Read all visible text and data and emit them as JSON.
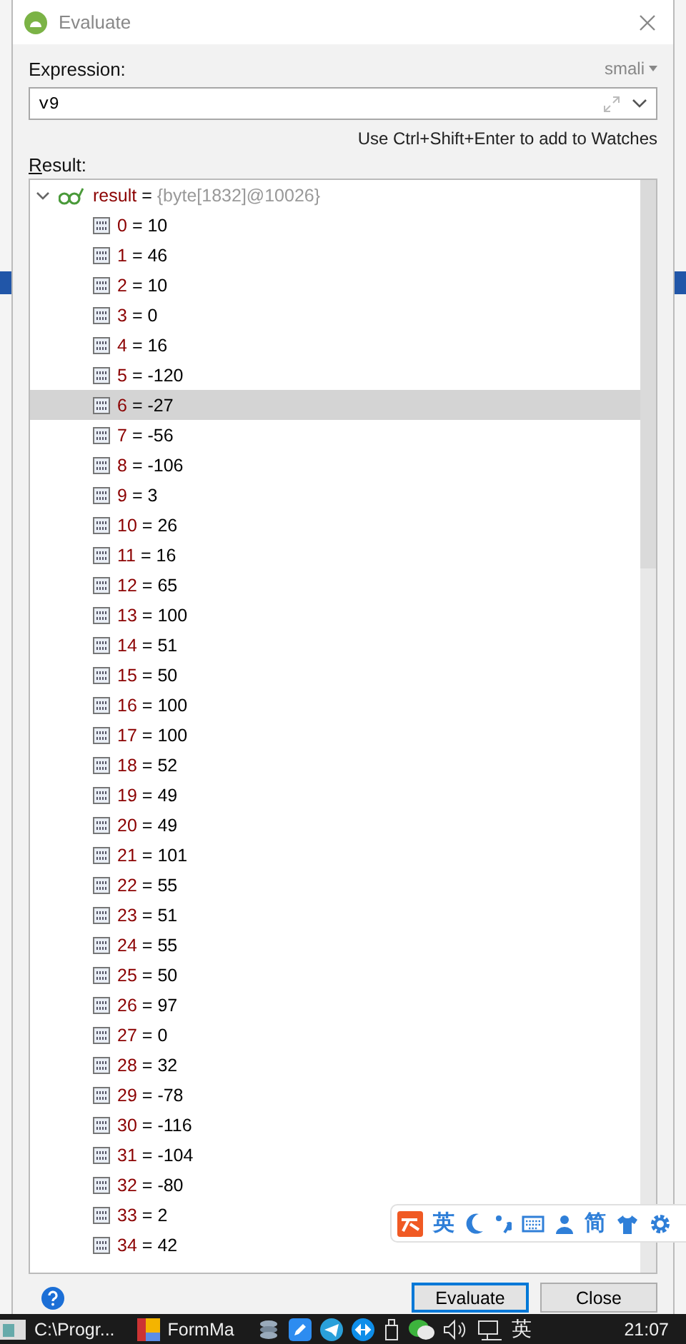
{
  "window": {
    "title": "Evaluate"
  },
  "expression": {
    "label": "Expression:",
    "language": "smali",
    "value": "v9"
  },
  "hint": "Use Ctrl+Shift+Enter to add to Watches",
  "result": {
    "label": "Result:",
    "separator": "=",
    "root": {
      "name": "result",
      "value": "{byte[1832]@10026}",
      "expanded": true,
      "children": [
        {
          "index": "0",
          "value": "10",
          "selected": false
        },
        {
          "index": "1",
          "value": "46",
          "selected": false
        },
        {
          "index": "2",
          "value": "10",
          "selected": false
        },
        {
          "index": "3",
          "value": "0",
          "selected": false
        },
        {
          "index": "4",
          "value": "16",
          "selected": false
        },
        {
          "index": "5",
          "value": "-120",
          "selected": false
        },
        {
          "index": "6",
          "value": "-27",
          "selected": true
        },
        {
          "index": "7",
          "value": "-56",
          "selected": false
        },
        {
          "index": "8",
          "value": "-106",
          "selected": false
        },
        {
          "index": "9",
          "value": "3",
          "selected": false
        },
        {
          "index": "10",
          "value": "26",
          "selected": false
        },
        {
          "index": "11",
          "value": "16",
          "selected": false
        },
        {
          "index": "12",
          "value": "65",
          "selected": false
        },
        {
          "index": "13",
          "value": "100",
          "selected": false
        },
        {
          "index": "14",
          "value": "51",
          "selected": false
        },
        {
          "index": "15",
          "value": "50",
          "selected": false
        },
        {
          "index": "16",
          "value": "100",
          "selected": false
        },
        {
          "index": "17",
          "value": "100",
          "selected": false
        },
        {
          "index": "18",
          "value": "52",
          "selected": false
        },
        {
          "index": "19",
          "value": "49",
          "selected": false
        },
        {
          "index": "20",
          "value": "49",
          "selected": false
        },
        {
          "index": "21",
          "value": "101",
          "selected": false
        },
        {
          "index": "22",
          "value": "55",
          "selected": false
        },
        {
          "index": "23",
          "value": "51",
          "selected": false
        },
        {
          "index": "24",
          "value": "55",
          "selected": false
        },
        {
          "index": "25",
          "value": "50",
          "selected": false
        },
        {
          "index": "26",
          "value": "97",
          "selected": false
        },
        {
          "index": "27",
          "value": "0",
          "selected": false
        },
        {
          "index": "28",
          "value": "32",
          "selected": false
        },
        {
          "index": "29",
          "value": "-78",
          "selected": false
        },
        {
          "index": "30",
          "value": "-116",
          "selected": false
        },
        {
          "index": "31",
          "value": "-104",
          "selected": false
        },
        {
          "index": "32",
          "value": "-80",
          "selected": false
        },
        {
          "index": "33",
          "value": "2",
          "selected": false
        },
        {
          "index": "34",
          "value": "42",
          "selected": false
        }
      ]
    }
  },
  "buttons": [
    {
      "label": "Evaluate",
      "kind": "default"
    },
    {
      "label": "Close",
      "kind": "normal"
    }
  ],
  "ime_toolbar": {
    "items": [
      {
        "kind": "logo"
      },
      {
        "kind": "text",
        "label": "英"
      },
      {
        "kind": "moon"
      },
      {
        "kind": "punct"
      },
      {
        "kind": "keyboard"
      },
      {
        "kind": "user"
      },
      {
        "kind": "text",
        "label": "简"
      },
      {
        "kind": "shirt"
      },
      {
        "kind": "gear"
      }
    ]
  },
  "taskbar": {
    "apps": [
      {
        "label": "C:\\Progr..."
      },
      {
        "label": "FormMa"
      }
    ],
    "tray": [
      {
        "kind": "stack"
      },
      {
        "kind": "pen"
      },
      {
        "kind": "send"
      },
      {
        "kind": "remote"
      },
      {
        "kind": "usb"
      },
      {
        "kind": "chat"
      },
      {
        "kind": "volume"
      },
      {
        "kind": "network"
      }
    ],
    "ime": "英",
    "clock": "21:07"
  }
}
